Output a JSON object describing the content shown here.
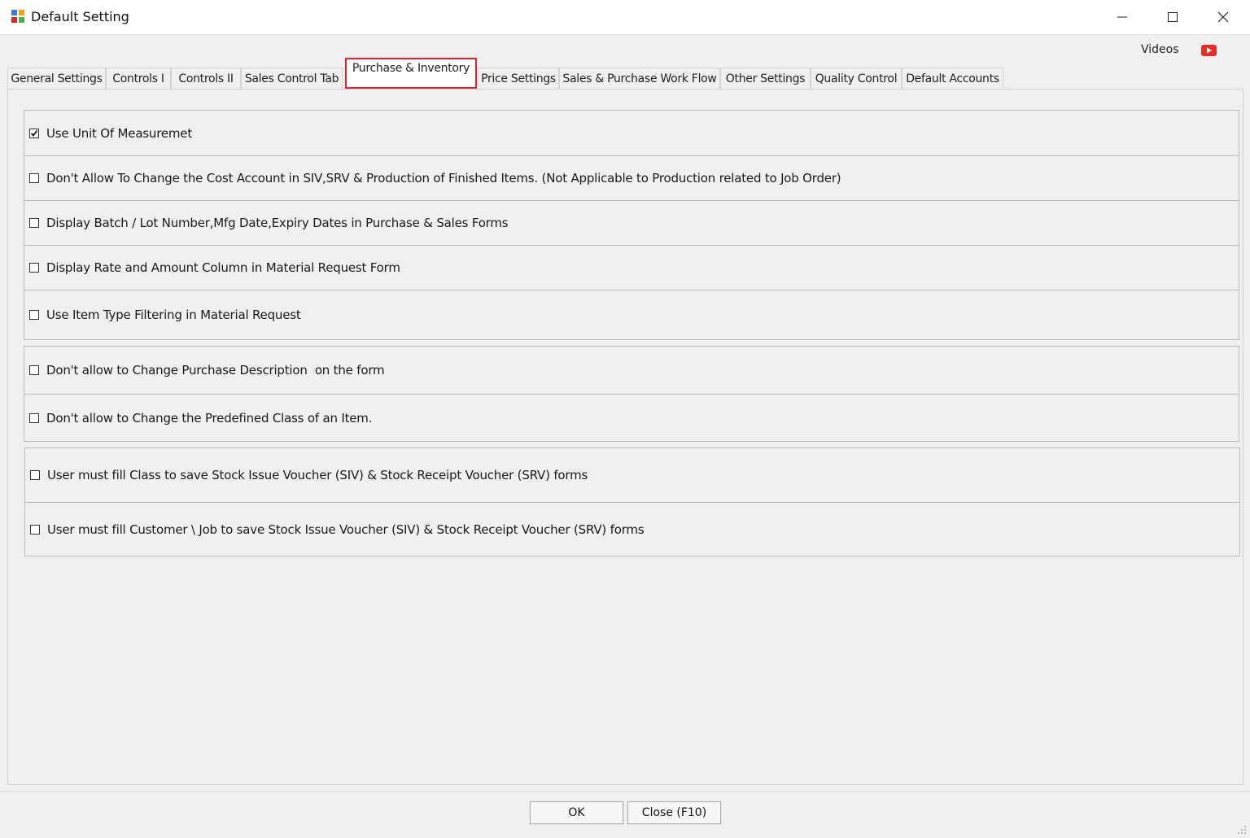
{
  "window": {
    "title": "Default Setting",
    "icon": "app-grid-icon"
  },
  "header": {
    "videos_label": "Videos",
    "video_icon": "youtube-icon"
  },
  "tabs": [
    {
      "label": "General Settings"
    },
    {
      "label": "Controls I"
    },
    {
      "label": "Controls II"
    },
    {
      "label": "Sales Control Tab"
    },
    {
      "label": "Purchase & Inventory",
      "active": true
    },
    {
      "label": "Price Settings"
    },
    {
      "label": "Sales & Purchase Work Flow"
    },
    {
      "label": "Other Settings"
    },
    {
      "label": "Quality Control"
    },
    {
      "label": "Default Accounts"
    }
  ],
  "groups": [
    {
      "options": [
        {
          "label": "Use Unit Of Measuremet",
          "checked": true
        },
        {
          "label": "Don't Allow To Change the Cost Account in SIV,SRV & Production of Finished Items. (Not Applicable to Production related to Job Order)",
          "checked": false
        },
        {
          "label": "Display Batch / Lot Number,Mfg Date,Expiry Dates in Purchase & Sales Forms",
          "checked": false
        },
        {
          "label": "Display Rate and Amount Column in Material Request Form",
          "checked": false
        },
        {
          "label": "Use Item Type Filtering in Material Request",
          "checked": false
        }
      ]
    },
    {
      "options": [
        {
          "label": "Don't allow to Change Purchase Description  on the form",
          "checked": false
        },
        {
          "label": "Don't allow to Change the Predefined Class of an Item.",
          "checked": false
        }
      ]
    },
    {
      "options": [
        {
          "label": "User must fill Class to save Stock Issue Voucher (SIV) & Stock Receipt Voucher (SRV) forms",
          "checked": false
        },
        {
          "label": "User must fill Customer \\ Job to save Stock Issue Voucher (SIV) & Stock Receipt Voucher (SRV) forms",
          "checked": false
        }
      ]
    }
  ],
  "footer": {
    "ok_label": "OK",
    "close_label": "Close (F10)"
  },
  "colors": {
    "active_tab_highlight": "#d9262c",
    "youtube_red": "#e52d27"
  }
}
